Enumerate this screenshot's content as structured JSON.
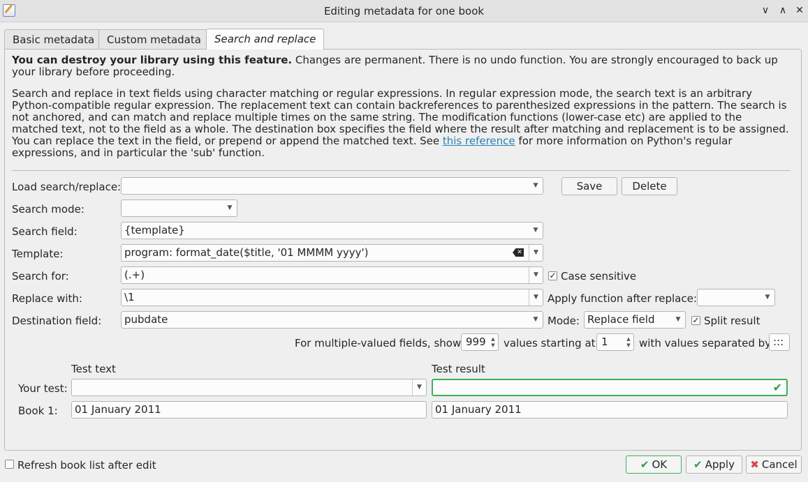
{
  "window": {
    "title": "Editing metadata for one book",
    "minimize": "∨",
    "maximize": "∧",
    "close": "✕"
  },
  "tabs": [
    {
      "label": "Basic metadata"
    },
    {
      "label": "Custom metadata"
    },
    {
      "label": "Search and replace"
    }
  ],
  "warning": {
    "bold": "You can destroy your library using this feature.",
    "rest": " Changes are permanent. There is no undo function. You are strongly encouraged to back up your library before proceeding."
  },
  "help": {
    "before_link": "Search and replace in text fields using character matching or regular expressions. In regular expression mode, the search text is an arbitrary Python-compatible regular expression. The replacement text can contain backreferences to parenthesized expressions in the pattern. The search is not anchored, and can match and replace multiple times on the same string. The modification functions (lower-case etc) are applied to the matched text, not to the field as a whole. The destination box specifies the field where the result after matching and replacement is to be assigned. You can replace the text in the field, or prepend or append the matched text. See ",
    "link": "this reference",
    "after_link": " for more information on Python's regular expressions, and in particular the 'sub' function."
  },
  "form": {
    "load_label": "Load search/replace:",
    "load_value": "",
    "save_button": "Save",
    "delete_button": "Delete",
    "mode_label": "Search mode:",
    "mode_value": "",
    "field_label": "Search field:",
    "field_value": "{template}",
    "template_label": "Template:",
    "template_value": "program:   format_date($title, '01 MMMM yyyy')",
    "search_for_label": "Search for:",
    "search_for_value": "(.+)",
    "case_sensitive_label": "Case sensitive",
    "case_sensitive_checked": true,
    "replace_label": "Replace with:",
    "replace_value": "\\1",
    "apply_func_label": "Apply function after replace:",
    "apply_func_value": "",
    "dest_label": "Destination field:",
    "dest_value": "pubdate",
    "mode2_label": "Mode:",
    "mode2_value": "Replace field",
    "split_label": "Split result",
    "split_checked": true,
    "multi_prefix": "For multiple-valued fields, show",
    "multi_count": "999",
    "multi_mid": "values starting at",
    "multi_start": "1",
    "multi_suffix": "with values separated by",
    "multi_sep": ":::"
  },
  "test": {
    "text_header": "Test text",
    "result_header": "Test result",
    "your_test_label": "Your test:",
    "your_test_value": "",
    "your_test_result": "",
    "book1_label": "Book 1:",
    "book1_text": "01 January 2011",
    "book1_result": "01 January 2011"
  },
  "footer": {
    "refresh_label": "Refresh book list after edit",
    "refresh_checked": false,
    "ok": "OK",
    "apply": "Apply",
    "cancel": "Cancel"
  },
  "colors": {
    "accent_green": "#3daf5a",
    "cancel_red": "#da4453",
    "link_blue": "#2980b9"
  }
}
